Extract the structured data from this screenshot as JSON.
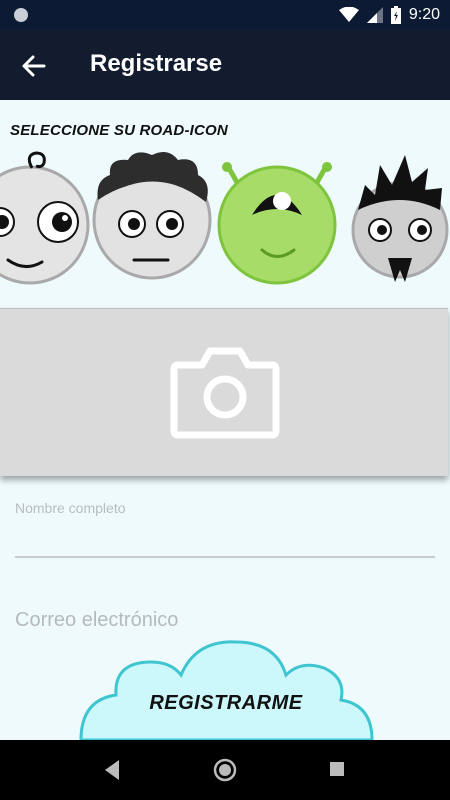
{
  "status_bar": {
    "time": "9:20"
  },
  "app_bar": {
    "title": "Registrarse"
  },
  "avatar_section": {
    "label": "SELECCIONE SU ROAD-ICON",
    "avatars": [
      "baby-face-icon",
      "curly-hair-face-icon",
      "green-alien-icon",
      "spiky-hair-face-icon"
    ]
  },
  "photo": {
    "icon": "camera-icon"
  },
  "form": {
    "full_name_label": "Nombre completo",
    "full_name_value": "",
    "email_placeholder": "Correo electrónico"
  },
  "register_button": {
    "label": "REGISTRARME",
    "cloud_color": "#ccf8fb",
    "cloud_stroke": "#3ec5d0"
  },
  "colors": {
    "status_bar": "#0d1a33",
    "app_bar": "#121c2e",
    "background": "#eefafc",
    "alien": "#a6dc67"
  }
}
